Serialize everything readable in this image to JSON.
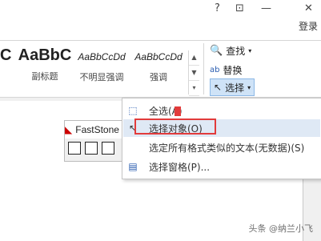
{
  "window": {
    "help": "?",
    "restore": "⊡",
    "minimize": "—",
    "close": "✕",
    "login": "登录"
  },
  "styles": [
    {
      "preview": "C",
      "name": ""
    },
    {
      "preview": "AaBbC",
      "name": "副标题"
    },
    {
      "preview": "AaBbCcDd",
      "name": "不明显强调"
    },
    {
      "preview": "AaBbCcDd",
      "name": "强调"
    }
  ],
  "editing": {
    "find": "查找",
    "replace": "替换",
    "select": "选择"
  },
  "fs_app": {
    "title": "FastStone"
  },
  "menu": {
    "items": [
      {
        "label": "全选(A)"
      },
      {
        "label": "选择对象(O)"
      },
      {
        "label": "选定所有格式类似的文本(无数据)(S)"
      },
      {
        "label": "选择窗格(P)..."
      }
    ]
  },
  "watermark": "头条 @纳兰小飞"
}
